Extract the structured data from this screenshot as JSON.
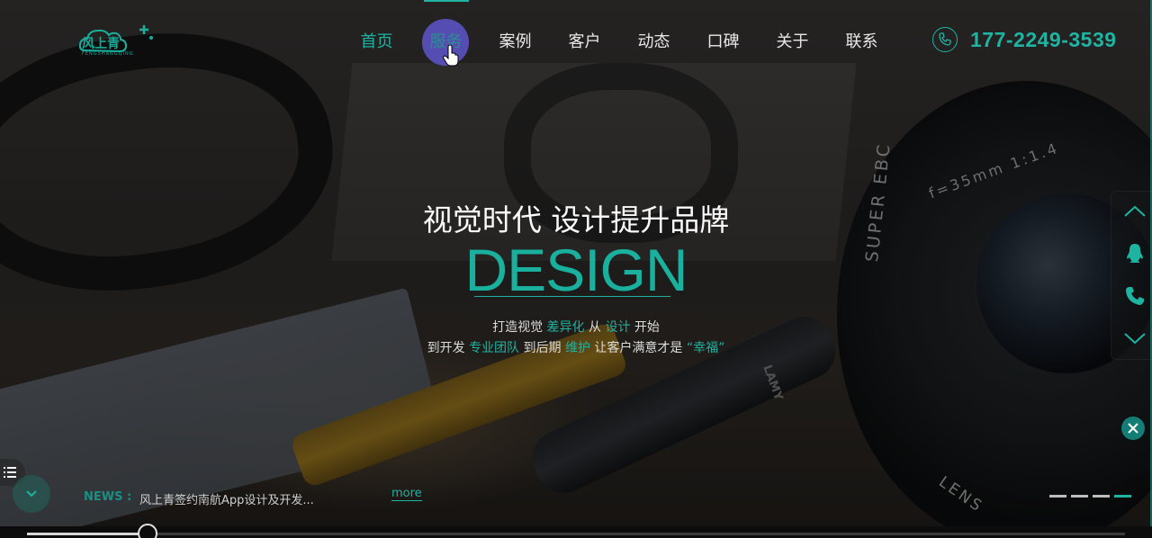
{
  "brand": {
    "logo_text": "风上青",
    "logo_sub": "FENGSHANGQING"
  },
  "nav": {
    "items": [
      {
        "label": "首页",
        "state": "active"
      },
      {
        "label": "服务",
        "state": "hover"
      },
      {
        "label": "案例",
        "state": "normal"
      },
      {
        "label": "客户",
        "state": "normal"
      },
      {
        "label": "动态",
        "state": "normal"
      },
      {
        "label": "口碑",
        "state": "normal"
      },
      {
        "label": "关于",
        "state": "normal"
      },
      {
        "label": "联系",
        "state": "normal"
      }
    ]
  },
  "contact": {
    "phone": "177-2249-3539",
    "icon": "phone-icon"
  },
  "hero": {
    "title": "视觉时代 设计提升品牌",
    "design": "DESIGN",
    "line1": {
      "a": "打造视觉 ",
      "b": "差异化",
      "c": " 从 ",
      "d": "设计",
      "e": " 开始"
    },
    "line2": {
      "a": "到开发 ",
      "b": "专业团队",
      "c": " 到后期 ",
      "d": "维护",
      "e": " 让客户满意才是 ",
      "f": "“幸福”"
    },
    "pen_brand": "LAMY",
    "lens_text_1": "SUPER EBC",
    "lens_text_2": "f=35mm 1:1.4",
    "lens_text_3": "LENS"
  },
  "sidebar": {
    "buttons": [
      "chevron-up-icon",
      "qq-icon",
      "phone-icon",
      "chevron-down-icon"
    ]
  },
  "news": {
    "label": "NEWS :",
    "headline": "风上青签约南航App设计及开发...",
    "more": "more"
  },
  "slider": {
    "total": 4,
    "active_index": 3
  },
  "progress": {
    "value": 0.11
  },
  "colors": {
    "accent": "#1fb3a1",
    "hover_circle": "#5f55cd",
    "text": "#e8e8e8"
  }
}
